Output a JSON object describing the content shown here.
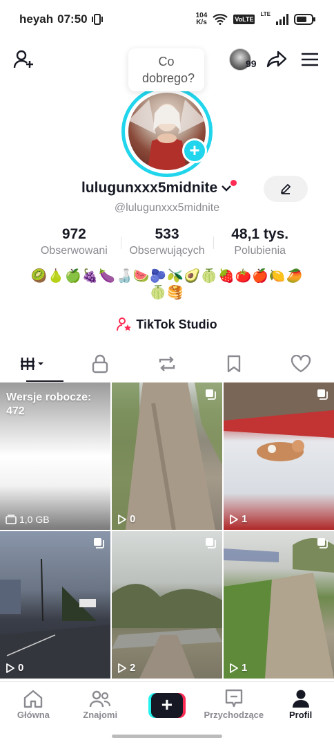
{
  "status_bar": {
    "carrier": "heyah",
    "time": "07:50",
    "speed_value": "104",
    "speed_unit": "K/s",
    "volte": "VoLTE",
    "lte": "LTE"
  },
  "top": {
    "bubble_text": "Co dobrego?",
    "badge_count": "99"
  },
  "profile": {
    "username": "lulugunxxx5midnite",
    "handle": "@lulugunxxx5midnite",
    "stats": [
      {
        "value": "972",
        "label": "Obserwowani"
      },
      {
        "value": "533",
        "label": "Obserwujących"
      },
      {
        "value": "48,1 tys.",
        "label": "Polubienia"
      }
    ],
    "bio_line1": "🥝🍐🍏🍇🍆🍶🍉🫐🫒🥑🍈🍓🍅🍎🍋🥭",
    "bio_line2": "🍈🥞",
    "studio_label": "TikTok Studio"
  },
  "grid": {
    "drafts_label": "Wersje robocze:",
    "drafts_count": "472",
    "drafts_size": "1,0 GB",
    "videos": [
      {
        "views": "0"
      },
      {
        "views": "1"
      },
      {
        "views": "0"
      },
      {
        "views": "2"
      },
      {
        "views": "1"
      }
    ]
  },
  "bottom_nav": {
    "home": "Główna",
    "friends": "Znajomi",
    "create": "+",
    "inbox": "Przychodzące",
    "profile": "Profil"
  },
  "colors": {
    "accent_cyan": "#20d5ec",
    "accent_red": "#fe2c55",
    "text_primary": "#161823",
    "text_secondary": "#8a8b91"
  }
}
